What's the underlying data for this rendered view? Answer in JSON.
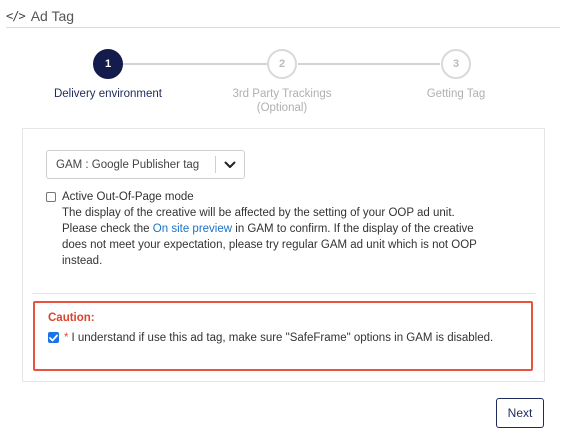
{
  "header": {
    "icon": "code-icon",
    "icon_glyph": "</>",
    "title": "Ad Tag"
  },
  "stepper": {
    "steps": [
      {
        "number": "1",
        "label": "Delivery environment",
        "sublabel": "",
        "state": "active"
      },
      {
        "number": "2",
        "label": "3rd Party Trackings",
        "sublabel": "(Optional)",
        "state": "inactive"
      },
      {
        "number": "3",
        "label": "Getting Tag",
        "sublabel": "",
        "state": "inactive"
      }
    ]
  },
  "delivery": {
    "select_value": "GAM : Google Publisher tag",
    "oop_label": "Active Out-Of-Page mode",
    "oop_checked": false,
    "oop_desc_1": "The display of the creative will be affected by the setting of your OOP ad unit.",
    "oop_desc_2a": "Please check the",
    "oop_link": "On site preview",
    "oop_desc_2b": "in GAM to confirm. If the display of the creative",
    "oop_desc_3": "does not meet your expectation, please try regular GAM ad unit which is not OOP",
    "oop_desc_4": "instead."
  },
  "caution": {
    "title": "Caution:",
    "required_mark": "*",
    "text": "I understand if use this ad tag, make sure \"SafeFrame\" options in GAM is disabled.",
    "checked": true
  },
  "footer": {
    "next_label": "Next"
  },
  "colors": {
    "accent": "#141b4d",
    "link": "#1a73c8",
    "caution": "#e8533f",
    "checkbox": "#1a73e8"
  }
}
